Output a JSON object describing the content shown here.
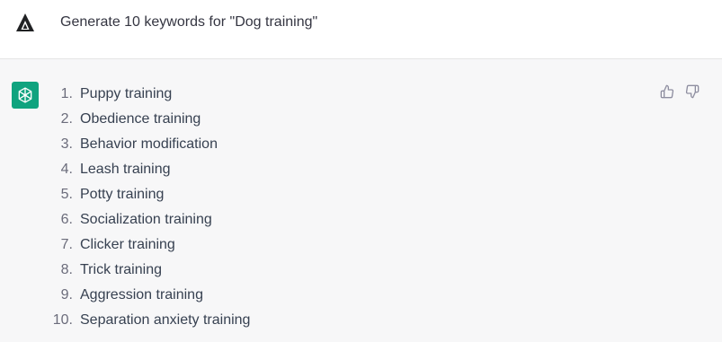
{
  "prompt": {
    "avatar_icon": "triangle-logo-icon",
    "text": "Generate 10 keywords for \"Dog training\""
  },
  "response": {
    "avatar_icon": "openai-logo-icon",
    "avatar_color": "#10a37f",
    "items": [
      {
        "number": "1.",
        "label": "Puppy training"
      },
      {
        "number": "2.",
        "label": "Obedience training"
      },
      {
        "number": "3.",
        "label": "Behavior modification"
      },
      {
        "number": "4.",
        "label": "Leash training"
      },
      {
        "number": "5.",
        "label": "Potty training"
      },
      {
        "number": "6.",
        "label": "Socialization training"
      },
      {
        "number": "7.",
        "label": "Clicker training"
      },
      {
        "number": "8.",
        "label": "Trick training"
      },
      {
        "number": "9.",
        "label": "Aggression training"
      },
      {
        "number": "10.",
        "label": "Separation anxiety training"
      }
    ],
    "feedback": {
      "like_icon": "thumbs-up-icon",
      "dislike_icon": "thumbs-down-icon"
    }
  }
}
